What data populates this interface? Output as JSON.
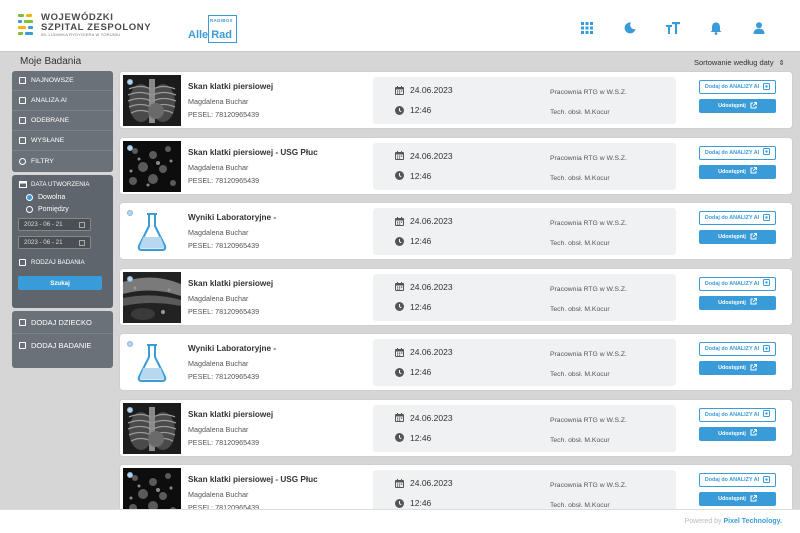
{
  "header": {
    "logo_line1": "WOJEWÓDZKI",
    "logo_line2": "SZPITAL ZESPOLONY",
    "logo_line3": "IM. LUDWIKA RYDYGIERA W TORUNIU",
    "allerad_small": "RADIBOX",
    "allerad_big": "Alle Rad",
    "icons": [
      "grid-icon",
      "moon-icon",
      "text-size-icon",
      "bell-icon",
      "user-icon"
    ]
  },
  "page": {
    "title": "Moje Badania",
    "sort_label": "Sortowanie według daty",
    "sort_arrow": "⇕"
  },
  "filters": {
    "items": [
      "NAJNOWSZE",
      "ANALIZA AI",
      "ODEBRANE",
      "WYSŁANE",
      "FILTRY"
    ],
    "date_header": "DATA UTWORZENIA",
    "radio_any": "Dowolna",
    "radio_between": "Pomiędzy",
    "date_from": "2023 - 06 - 21",
    "date_to": "2023 - 06 - 21",
    "exam_type": "RODZAJ BADANIA",
    "search_button": "Szukaj",
    "add_child": "DODAJ DZIECKO",
    "add_exam": "DODAJ BADANIE"
  },
  "cards": [
    {
      "kind": "xray",
      "title": "Skan klatki piersiowej",
      "name": "Magdalena Buchar",
      "pesel": "PESEL: 78120965439",
      "date": "24.06.2023",
      "time": "12:46",
      "location": "Pracownia RTG  w W.S.Z.",
      "tech": "Tech. obsł. M.Kocur",
      "ai_button": "Dodaj do ANALIZY AI",
      "share_button": "Udostępnij"
    },
    {
      "kind": "usg",
      "title": "Skan klatki piersiowej - USG Płuc",
      "name": "Magdalena Buchar",
      "pesel": "PESEL: 78120965439",
      "date": "24.06.2023",
      "time": "12:46",
      "location": "Pracownia RTG  w W.S.Z.",
      "tech": "Tech. obsł. M.Kocur",
      "ai_button": "Dodaj do ANALIZY AI",
      "share_button": "Udostępnij"
    },
    {
      "kind": "lab",
      "title": "Wyniki Laboratoryjne -",
      "name": "Magdalena Buchar",
      "pesel": "PESEL: 78120965439",
      "date": "24.06.2023",
      "time": "12:46",
      "location": "Pracownia RTG  w W.S.Z.",
      "tech": "Tech. obsł. M.Kocur",
      "ai_button": "Dodaj do ANALIZY AI",
      "share_button": "Udostępnij"
    },
    {
      "kind": "usg2",
      "title": "Skan klatki piersiowej",
      "name": "Magdalena Buchar",
      "pesel": "PESEL: 78120965439",
      "date": "24.06.2023",
      "time": "12:46",
      "location": "Pracownia RTG  w W.S.Z.",
      "tech": "Tech. obsł. M.Kocur",
      "ai_button": "Dodaj do ANALIZY AI",
      "share_button": "Udostępnij"
    },
    {
      "kind": "lab",
      "title": "Wyniki Laboratoryjne -",
      "name": "Magdalena Buchar",
      "pesel": "PESEL: 78120965439",
      "date": "24.06.2023",
      "time": "12:46",
      "location": "Pracownia RTG  w W.S.Z.",
      "tech": "Tech. obsł. M.Kocur",
      "ai_button": "Dodaj do ANALIZY AI",
      "share_button": "Udostępnij"
    },
    {
      "kind": "xray",
      "title": "Skan klatki piersiowej",
      "name": "Magdalena Buchar",
      "pesel": "PESEL: 78120965439",
      "date": "24.06.2023",
      "time": "12:46",
      "location": "Pracownia RTG  w W.S.Z.",
      "tech": "Tech. obsł. M.Kocur",
      "ai_button": "Dodaj do ANALIZY AI",
      "share_button": "Udostępnij"
    },
    {
      "kind": "usg",
      "title": "Skan klatki piersiowej - USG Płuc",
      "name": "Magdalena Buchar",
      "pesel": "PESEL: 78120965439",
      "date": "24.06.2023",
      "time": "12:46",
      "location": "Pracownia RTG  w W.S.Z.",
      "tech": "Tech. obsł. M.Kocur",
      "ai_button": "Dodaj do ANALIZY AI",
      "share_button": "Udostępnij"
    }
  ],
  "footer": {
    "powered_prefix": "Powered by ",
    "powered_brand": "Pixel Technology."
  },
  "colors": {
    "accent": "#3a9bd9",
    "panel": "#6b7178",
    "background": "#d6d6d6"
  }
}
